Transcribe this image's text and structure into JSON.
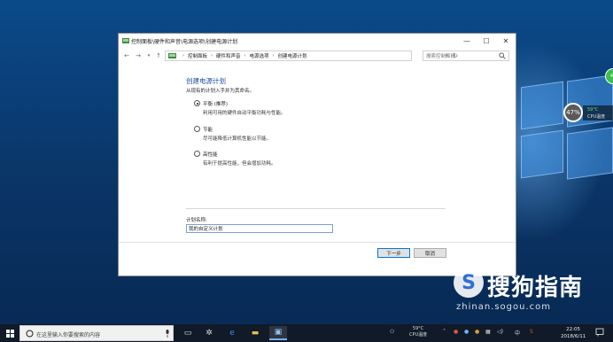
{
  "window": {
    "title": "控制面板\\硬件和声音\\电源选项\\创建电源计划",
    "controls": {
      "minimize": "—",
      "maximize": "☐",
      "close": "✕"
    }
  },
  "address_bar": {
    "breadcrumbs": [
      "控制面板",
      "硬件和声音",
      "电源选项",
      "创建电源计划"
    ],
    "search_placeholder": "搜索控制面板"
  },
  "page": {
    "heading": "创建电源计划",
    "subheading": "从现有的计划入手并为其命名。",
    "options": [
      {
        "label": "平衡 (推荐)",
        "description": "利用可用的硬件自动平衡功耗与性能。",
        "checked": true
      },
      {
        "label": "节能",
        "description": "尽可能降低计算机性能以节能。",
        "checked": false
      },
      {
        "label": "高性能",
        "description": "有利于提高性能，但会增加功耗。",
        "checked": false
      }
    ],
    "plan_name_label": "计划名称:",
    "plan_name_value": "我的自定义计划",
    "next_button": "下一步",
    "cancel_button": "取消"
  },
  "desktop": {
    "cpu_usage": "47%",
    "cpu_temp": "59°C",
    "cpu_temp_label": "CPU温度",
    "badge": "41",
    "watermark": "搜狗指南",
    "watermark_url": "zhinan.sogou.com"
  },
  "taskbar": {
    "search_placeholder": "在这里输入你要搜索的内容",
    "tray_temp": "59°C",
    "tray_temp_label": "CPU温度",
    "ime_label": "中",
    "time": "22:05",
    "date": "2018/6/11"
  },
  "colors": {
    "accent": "#0078d7",
    "heading": "#1e4fa0",
    "taskbar": "#101a28",
    "temp_green": "#5fe07a"
  }
}
